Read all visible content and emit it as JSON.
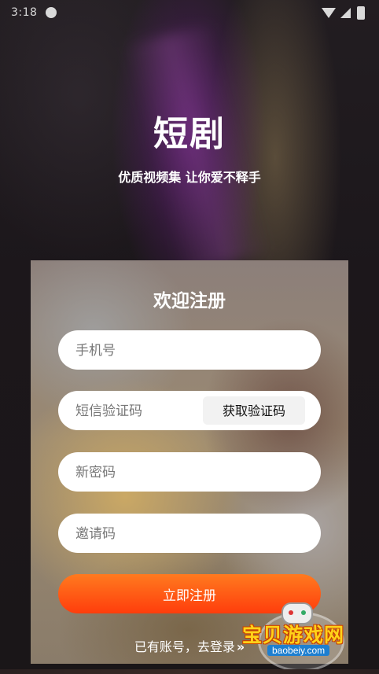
{
  "status_bar": {
    "time": "3:18"
  },
  "app": {
    "title": "短剧",
    "subtitle": "优质视频集 让你爱不释手"
  },
  "register_card": {
    "title": "欢迎注册",
    "phone_placeholder": "手机号",
    "sms_placeholder": "短信验证码",
    "get_code_label": "获取验证码",
    "password_placeholder": "新密码",
    "invite_placeholder": "邀请码",
    "submit_label": "立即注册",
    "login_link_text": "已有账号，去登录",
    "login_chevron": "»"
  },
  "watermark": {
    "name": "宝贝游戏网",
    "url": "baobeiy.com"
  },
  "colors": {
    "accent_start": "#ff7a1f",
    "accent_end": "#ff3d0c"
  }
}
